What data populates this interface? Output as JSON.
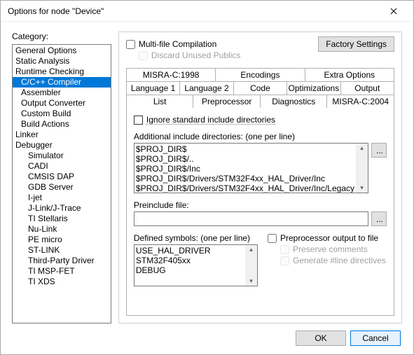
{
  "window": {
    "title": "Options for node \"Device\""
  },
  "category": {
    "label": "Category:",
    "items": [
      {
        "label": "General Options",
        "indent": 0
      },
      {
        "label": "Static Analysis",
        "indent": 0
      },
      {
        "label": "Runtime Checking",
        "indent": 0
      },
      {
        "label": "C/C++ Compiler",
        "indent": 1,
        "selected": true
      },
      {
        "label": "Assembler",
        "indent": 1
      },
      {
        "label": "Output Converter",
        "indent": 1
      },
      {
        "label": "Custom Build",
        "indent": 1
      },
      {
        "label": "Build Actions",
        "indent": 1
      },
      {
        "label": "Linker",
        "indent": 0
      },
      {
        "label": "Debugger",
        "indent": 0
      },
      {
        "label": "Simulator",
        "indent": 2
      },
      {
        "label": "CADI",
        "indent": 2
      },
      {
        "label": "CMSIS DAP",
        "indent": 2
      },
      {
        "label": "GDB Server",
        "indent": 2
      },
      {
        "label": "I-jet",
        "indent": 2
      },
      {
        "label": "J-Link/J-Trace",
        "indent": 2
      },
      {
        "label": "TI Stellaris",
        "indent": 2
      },
      {
        "label": "Nu-Link",
        "indent": 2
      },
      {
        "label": "PE micro",
        "indent": 2
      },
      {
        "label": "ST-LINK",
        "indent": 2
      },
      {
        "label": "Third-Party Driver",
        "indent": 2
      },
      {
        "label": "TI MSP-FET",
        "indent": 2
      },
      {
        "label": "TI XDS",
        "indent": 2
      }
    ]
  },
  "panel": {
    "factory_btn": "Factory Settings",
    "multi_file": "Multi-file Compilation",
    "discard_unused": "Discard Unused Publics",
    "tabs_row1": [
      "MISRA-C:1998",
      "Encodings",
      "Extra Options"
    ],
    "tabs_row2": [
      "Language 1",
      "Language 2",
      "Code",
      "Optimizations",
      "Output"
    ],
    "tabs_row3": [
      "List",
      "Preprocessor",
      "Diagnostics",
      "MISRA-C:2004"
    ],
    "ignore_std": "Ignore standard include directories",
    "additional_label": "Additional include directories: (one per line)",
    "additional_text": "$PROJ_DIR$\n$PROJ_DIR$/..\n$PROJ_DIR$/Inc\n$PROJ_DIR$/Drivers/STM32F4xx_HAL_Driver/Inc\n$PROJ_DIR$/Drivers/STM32F4xx_HAL_Driver/Inc/Legacy",
    "browse": "...",
    "preinclude_label": "Preinclude file:",
    "preinclude_value": "",
    "defined_label": "Defined symbols: (one per line)",
    "defined_text": "USE_HAL_DRIVER\nSTM32F405xx\nDEBUG",
    "pp_output": "Preprocessor output to file",
    "pp_preserve": "Preserve comments",
    "pp_line": "Generate #line directives"
  },
  "footer": {
    "ok": "OK",
    "cancel": "Cancel"
  }
}
